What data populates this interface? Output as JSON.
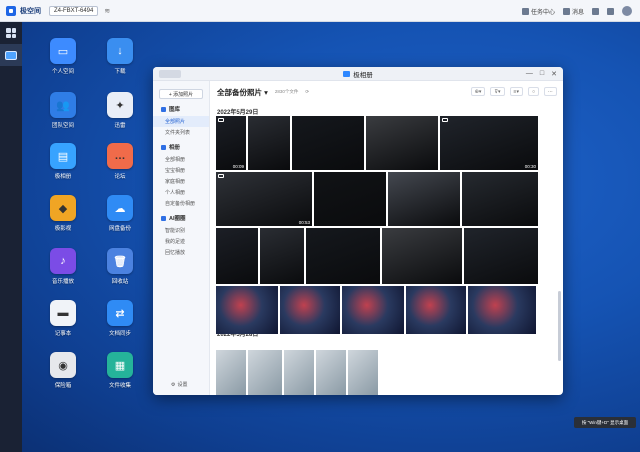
{
  "topbar": {
    "app_name": "极空间",
    "device": "Z4-FBXT-6494",
    "task_center": "任务中心",
    "messages": "消息"
  },
  "desktop_icons": [
    {
      "label": "个人空间",
      "icon": "folder-icon",
      "color": "#3d8bff",
      "glyph": "▭"
    },
    {
      "label": "下载",
      "icon": "download-icon",
      "color": "#3a8ef0",
      "glyph": "↓"
    },
    {
      "label": "团队空间",
      "icon": "team-folder-icon",
      "color": "#2f7de6",
      "glyph": "👥"
    },
    {
      "label": "迅雷",
      "icon": "xunlei-icon",
      "color": "#e9eef7",
      "glyph": "✦"
    },
    {
      "label": "极相册",
      "icon": "photos-icon",
      "color": "#37a3ff",
      "glyph": "▤"
    },
    {
      "label": "论坛",
      "icon": "forum-icon",
      "color": "#f06b4a",
      "glyph": "…"
    },
    {
      "label": "极影视",
      "icon": "video-icon",
      "color": "#f0a524",
      "glyph": "◆"
    },
    {
      "label": "网盘备份",
      "icon": "cloud-backup-icon",
      "color": "#2f8bf5",
      "glyph": "☁"
    },
    {
      "label": "音乐播放",
      "icon": "music-icon",
      "color": "#7b4ce6",
      "glyph": "♪"
    },
    {
      "label": "回收站",
      "icon": "trash-icon",
      "color": "#4b82e0",
      "glyph": "🗑"
    },
    {
      "label": "记事本",
      "icon": "notes-icon",
      "color": "#f0f3f8",
      "glyph": "▬"
    },
    {
      "label": "文档同步",
      "icon": "sync-icon",
      "color": "#2f8bf5",
      "glyph": "⇄"
    },
    {
      "label": "保险箱",
      "icon": "safe-icon",
      "color": "#e6e8ec",
      "glyph": "◉"
    },
    {
      "label": "文件收集",
      "icon": "collect-icon",
      "color": "#25b39a",
      "glyph": "▦"
    }
  ],
  "window": {
    "title": "极相册",
    "upload_button": "+ 添加照片",
    "sidebar": {
      "gallery_section": "图库",
      "gallery_items": [
        "全部照片",
        "文件夹列表"
      ],
      "albums_section": "相册",
      "album_items": [
        "全部相册",
        "宝宝相册",
        "家庭相册",
        "个人相册",
        "自定备份相册"
      ],
      "ai_section": "AI圈圈",
      "ai_items": [
        "智能识别",
        "我的足迹",
        "回忆播放"
      ],
      "settings": "设置"
    },
    "main": {
      "title": "全部备份照片 ▾",
      "count": "2830个文件",
      "groups": [
        {
          "date": "2022年5月29日"
        },
        {
          "date": "2022年5月28日"
        }
      ],
      "durations": [
        "00:09",
        "00:30",
        "00:53"
      ]
    }
  },
  "toast": "按 \"Win键+D\" 显示桌面"
}
